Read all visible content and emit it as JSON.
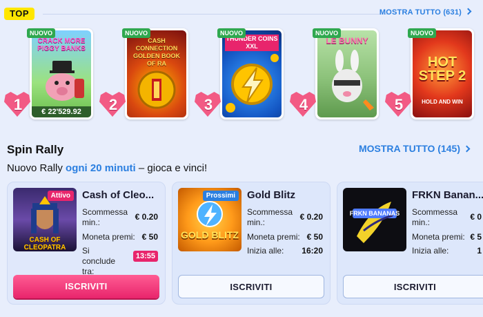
{
  "top": {
    "badge": "TOP",
    "show_all": "MOSTRA TUTTO (631)",
    "games": [
      {
        "title": "CRACK MORE PIGGY BANKS",
        "tag": "NUOVO",
        "rank": "1",
        "jackpot": "€ 22'529.92"
      },
      {
        "title": "CASH CONNECTION GOLDEN BOOK OF RA",
        "tag": "NUOVO",
        "rank": "2"
      },
      {
        "title": "THUNDER COINS XXL",
        "tag": "NUOVO",
        "rank": "3"
      },
      {
        "title": "LE BUNNY",
        "tag": "NUOVO",
        "rank": "4"
      },
      {
        "title": "HOT STEP 2",
        "subtitle": "HOLD AND WIN",
        "tag": "NUOVO",
        "rank": "5"
      }
    ]
  },
  "rally": {
    "title": "Spin Rally",
    "show_all": "MOSTRA TUTTO (145)",
    "subtitle_pre": "Nuovo Rally ",
    "subtitle_hl": "ogni 20 minuti",
    "subtitle_post": " – gioca e vinci!",
    "cards": [
      {
        "name": "Cash of Cleo...",
        "thumb_text": "CASH OF CLEOPATRA",
        "status": "Attivo",
        "bet_label": "Scommessa min.:",
        "bet_value": "€ 0.20",
        "prize_label": "Moneta premi:",
        "prize_value": "€ 50",
        "time_label": "Si conclude tra:",
        "time_value": "13:55",
        "button": "ISCRIVITI"
      },
      {
        "name": "Gold Blitz",
        "thumb_text": "GOLD BLITZ",
        "status": "Prossimi",
        "bet_label": "Scommessa min.:",
        "bet_value": "€ 0.20",
        "prize_label": "Moneta premi:",
        "prize_value": "€ 50",
        "time_label": "Inizia alle:",
        "time_value": "16:20",
        "button": "ISCRIVITI"
      },
      {
        "name": "FRKN Banan...",
        "thumb_text": "FRKN BANANAS",
        "bet_label": "Scommessa min.:",
        "bet_value": "€ 0",
        "prize_label": "Moneta premi:",
        "prize_value": "€ 5",
        "time_label": "Inizia alle:",
        "time_value": "1",
        "button": "ISCRIVITI"
      }
    ]
  },
  "colors": {
    "accent": "#2b7fe0",
    "primary_button": "#e8256c",
    "new_tag": "#2fa84f",
    "top_badge": "#ffe600",
    "rank_heart": "#f25a84"
  }
}
